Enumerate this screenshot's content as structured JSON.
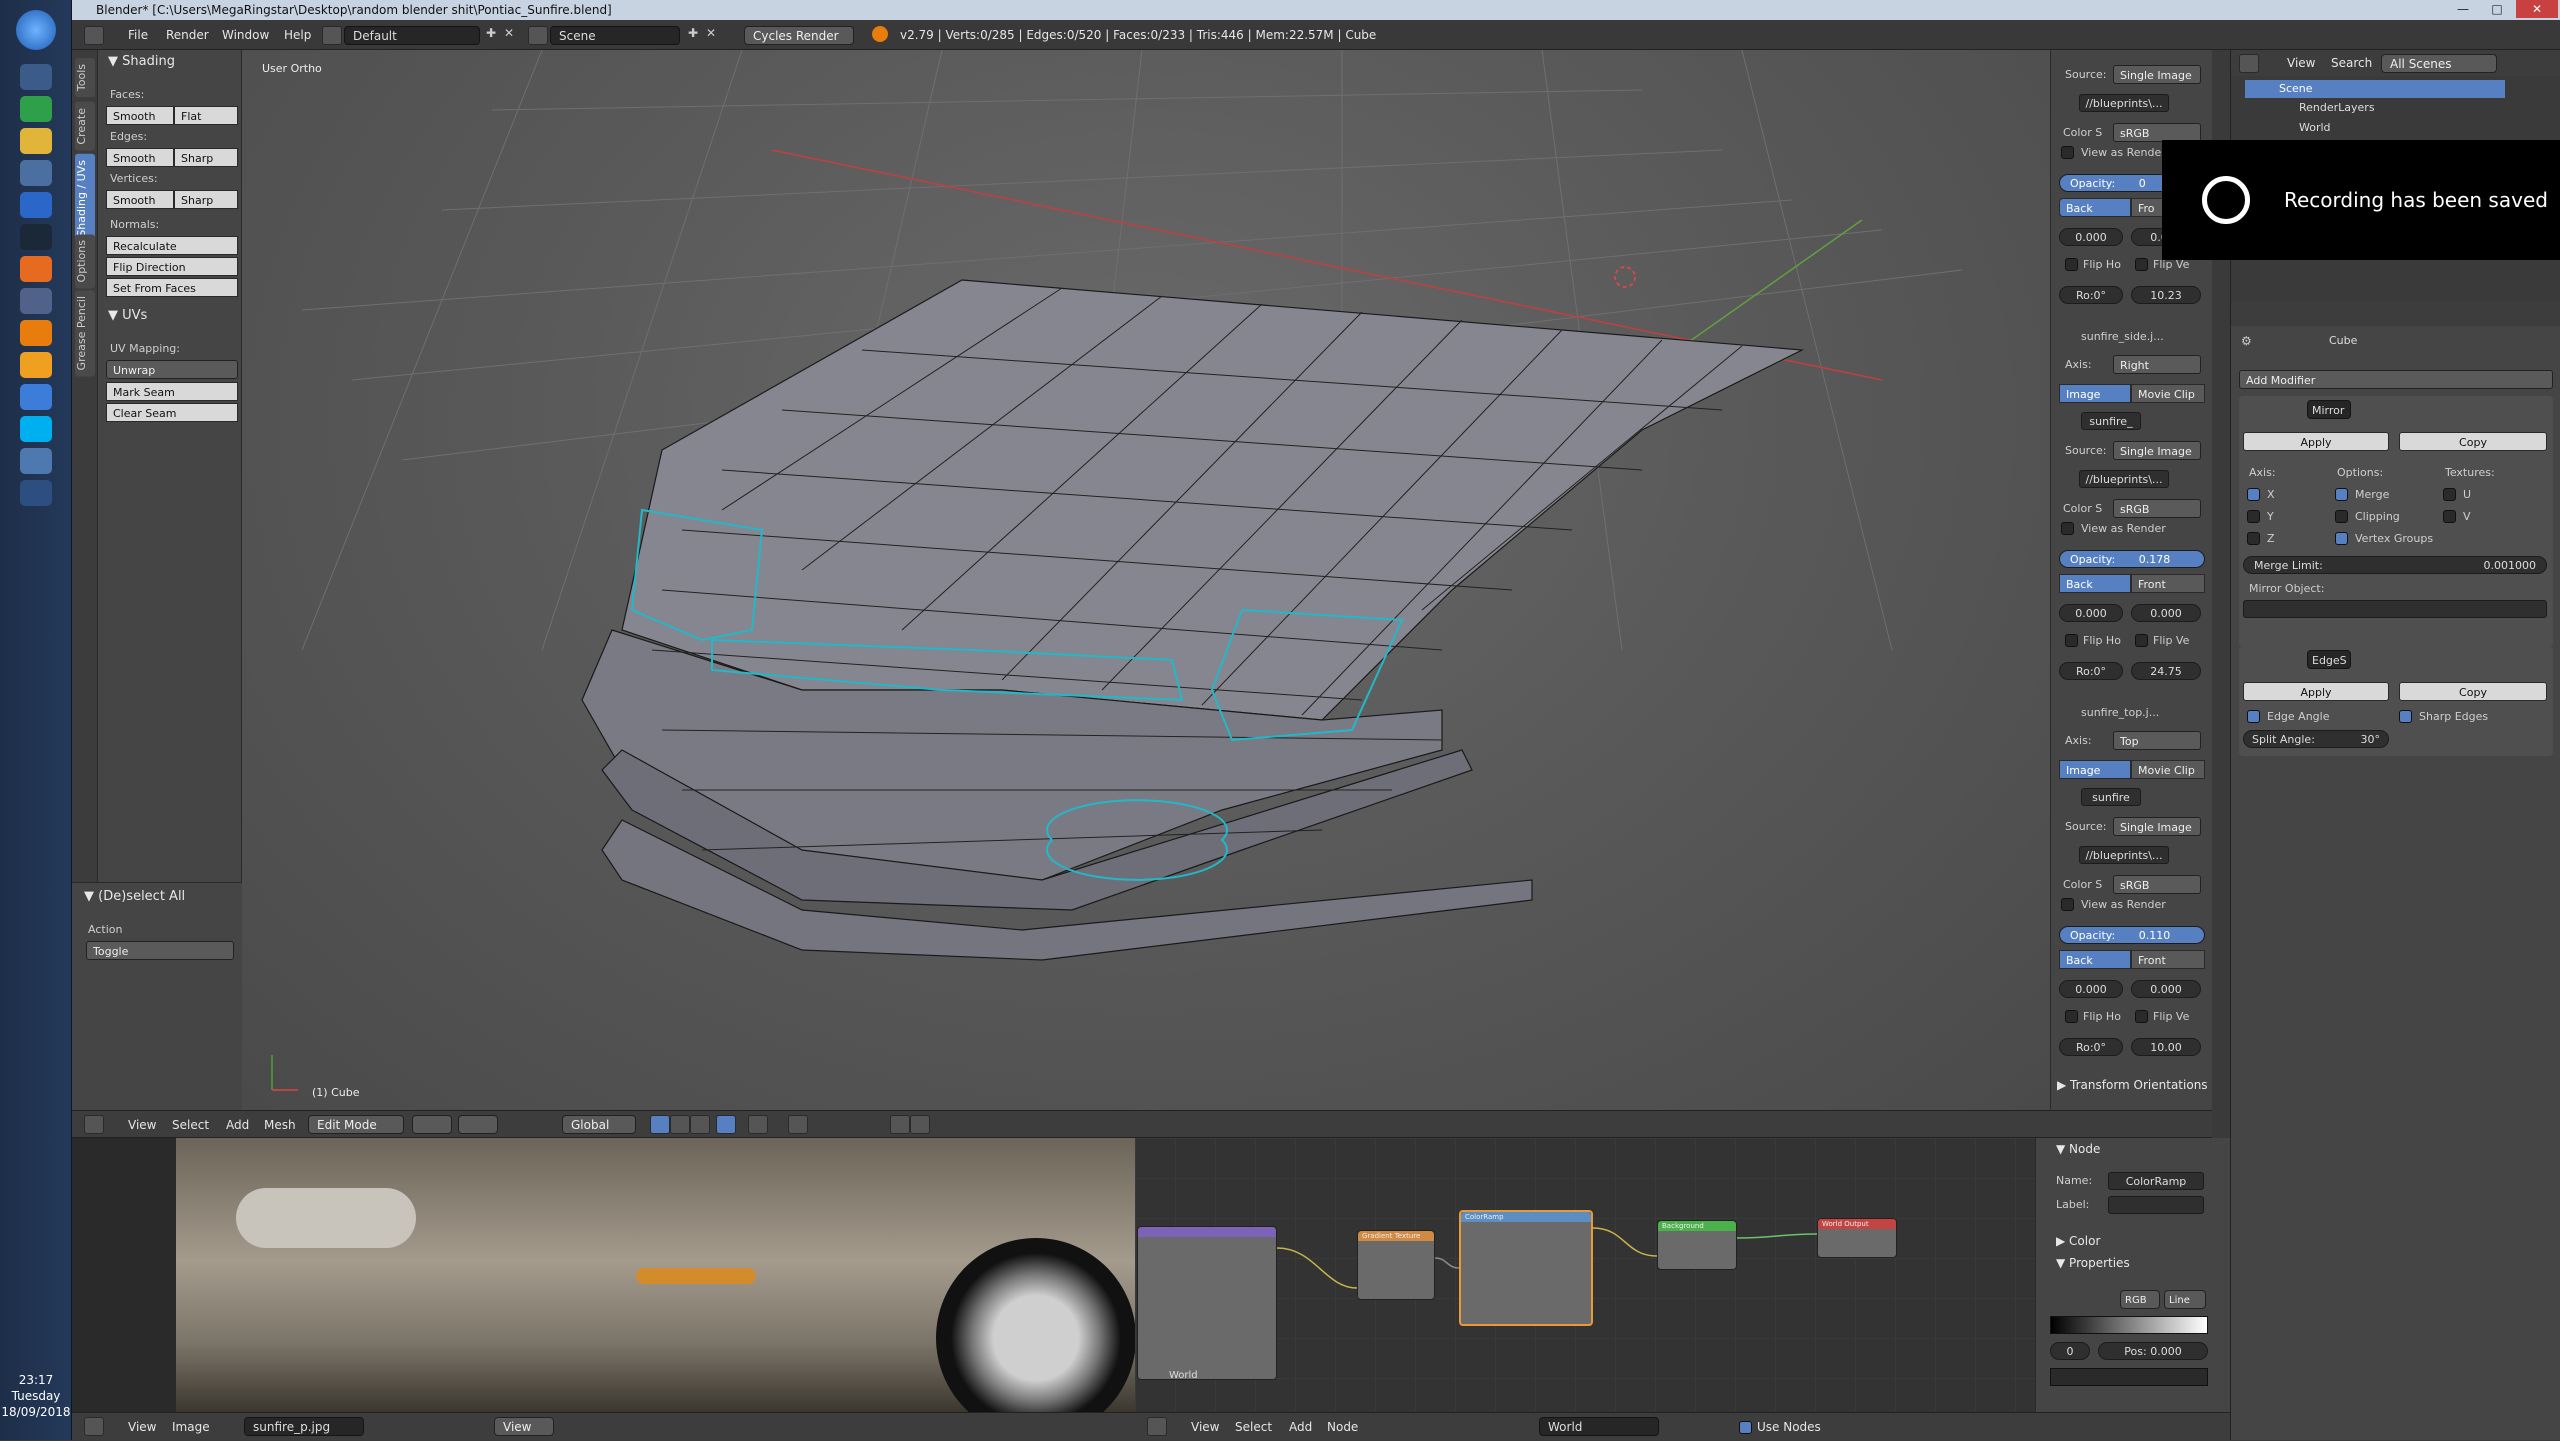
{
  "window": {
    "title": "Blender* [C:\\Users\\MegaRingstar\\Desktop\\random blender shit\\Pontiac_Sunfire.blend]"
  },
  "info": {
    "menus": [
      "File",
      "Render",
      "Window",
      "Help"
    ],
    "layout": "Default",
    "scene": "Scene",
    "engine": "Cycles Render",
    "stats": "v2.79 | Verts:0/285 | Edges:0/520 | Faces:0/233 | Tris:446 | Mem:22.57M | Cube"
  },
  "tool_tabs": [
    "Tools",
    "Create",
    "Shading / UVs",
    "Options",
    "Grease Pencil"
  ],
  "toolshelf": {
    "shading_title": "Shading",
    "faces_label": "Faces:",
    "edges_label": "Edges:",
    "vertices_label": "Vertices:",
    "smooth": "Smooth",
    "flat": "Flat",
    "sharp": "Sharp",
    "normals_label": "Normals:",
    "recalculate": "Recalculate",
    "flip_direction": "Flip Direction",
    "set_from_faces": "Set From Faces",
    "uvs_title": "UVs",
    "uv_mapping_label": "UV Mapping:",
    "unwrap": "Unwrap",
    "mark_seam": "Mark Seam",
    "clear_seam": "Clear Seam",
    "deselect_title": "(De)select All",
    "action_label": "Action",
    "toggle": "Toggle"
  },
  "viewport": {
    "label": "User Ortho",
    "object": "(1) Cube"
  },
  "viewport_header": {
    "menus": [
      "View",
      "Select",
      "Add",
      "Mesh"
    ],
    "mode": "Edit Mode",
    "orientation": "Global"
  },
  "npanel": {
    "source_label": "Source:",
    "single_image": "Single Image",
    "file": "//blueprints\\...",
    "color_label": "Color S",
    "srgb": "sRGB",
    "view_as_render": "View as Render",
    "opacity_label": "Opacity:",
    "back": "Back",
    "front": "Front",
    "fro": "Fro",
    "zero": "0.000",
    "flip_h": "Flip Ho",
    "flip_v": "Flip Ve",
    "axis_label": "Axis:",
    "image_tab": "Image",
    "movie_clip": "Movie Clip",
    "rot": "Ro:0°",
    "bg1": {
      "opacity": "0",
      "offset": "10.23"
    },
    "bg2": {
      "name": "sunfire_side.j...",
      "axis": "Right",
      "img": "sunfire_",
      "opacity": "0.178",
      "offset": "24.75"
    },
    "bg3": {
      "name": "sunfire_top.j...",
      "axis": "Top",
      "img": "sunfire",
      "opacity": "0.110",
      "offset": "10.00"
    },
    "transform_orientations": "Transform Orientations",
    "properties": "Properties"
  },
  "outliner": {
    "menus": [
      "View",
      "Search"
    ],
    "filter": "All Scenes",
    "items": [
      "Scene",
      "RenderLayers",
      "World"
    ]
  },
  "properties": {
    "object": "Cube",
    "add_modifier": "Add Modifier",
    "mirror": {
      "name": "Mirror",
      "apply": "Apply",
      "copy": "Copy",
      "axis_label": "Axis:",
      "options_label": "Options:",
      "textures_label": "Textures:",
      "x": "X",
      "y": "Y",
      "z": "Z",
      "merge": "Merge",
      "clipping": "Clipping",
      "vgroups": "Vertex Groups",
      "u": "U",
      "v": "V",
      "merge_limit_label": "Merge Limit:",
      "merge_limit": "0.001000",
      "mirror_object": "Mirror Object:"
    },
    "edgesplit": {
      "name": "EdgeS",
      "apply": "Apply",
      "copy": "Copy",
      "edge_angle": "Edge Angle",
      "sharp_edges": "Sharp Edges",
      "split_angle_label": "Split Angle:",
      "split_angle": "30°"
    }
  },
  "toast": {
    "text": "Recording has been saved"
  },
  "image_editor": {
    "menus": [
      "View",
      "Image"
    ],
    "image": "sunfire_p.jpg",
    "view": "View"
  },
  "node_editor": {
    "menus": [
      "View",
      "Select",
      "Add",
      "Node"
    ],
    "world": "World",
    "use_nodes": "Use Nodes",
    "world_label": "World"
  },
  "node_side": {
    "node_title": "Node",
    "name_label": "Name:",
    "name": "ColorRamp",
    "label_label": "Label:",
    "color": "Color",
    "properties": "Properties",
    "rgb": "RGB",
    "linear": "Line",
    "idx": "0",
    "pos": "Pos: 0.000"
  },
  "nodes": {
    "n1": "Gradient Texture",
    "n2": "ColorRamp",
    "n3": "Background",
    "n4": "World Output"
  },
  "clock": {
    "time": "23:17",
    "day": "Tuesday",
    "date": "18/09/2018"
  },
  "colors": {
    "accent": "#5680c2",
    "wire": "#1a1a1a",
    "seam": "#22b8c8"
  }
}
